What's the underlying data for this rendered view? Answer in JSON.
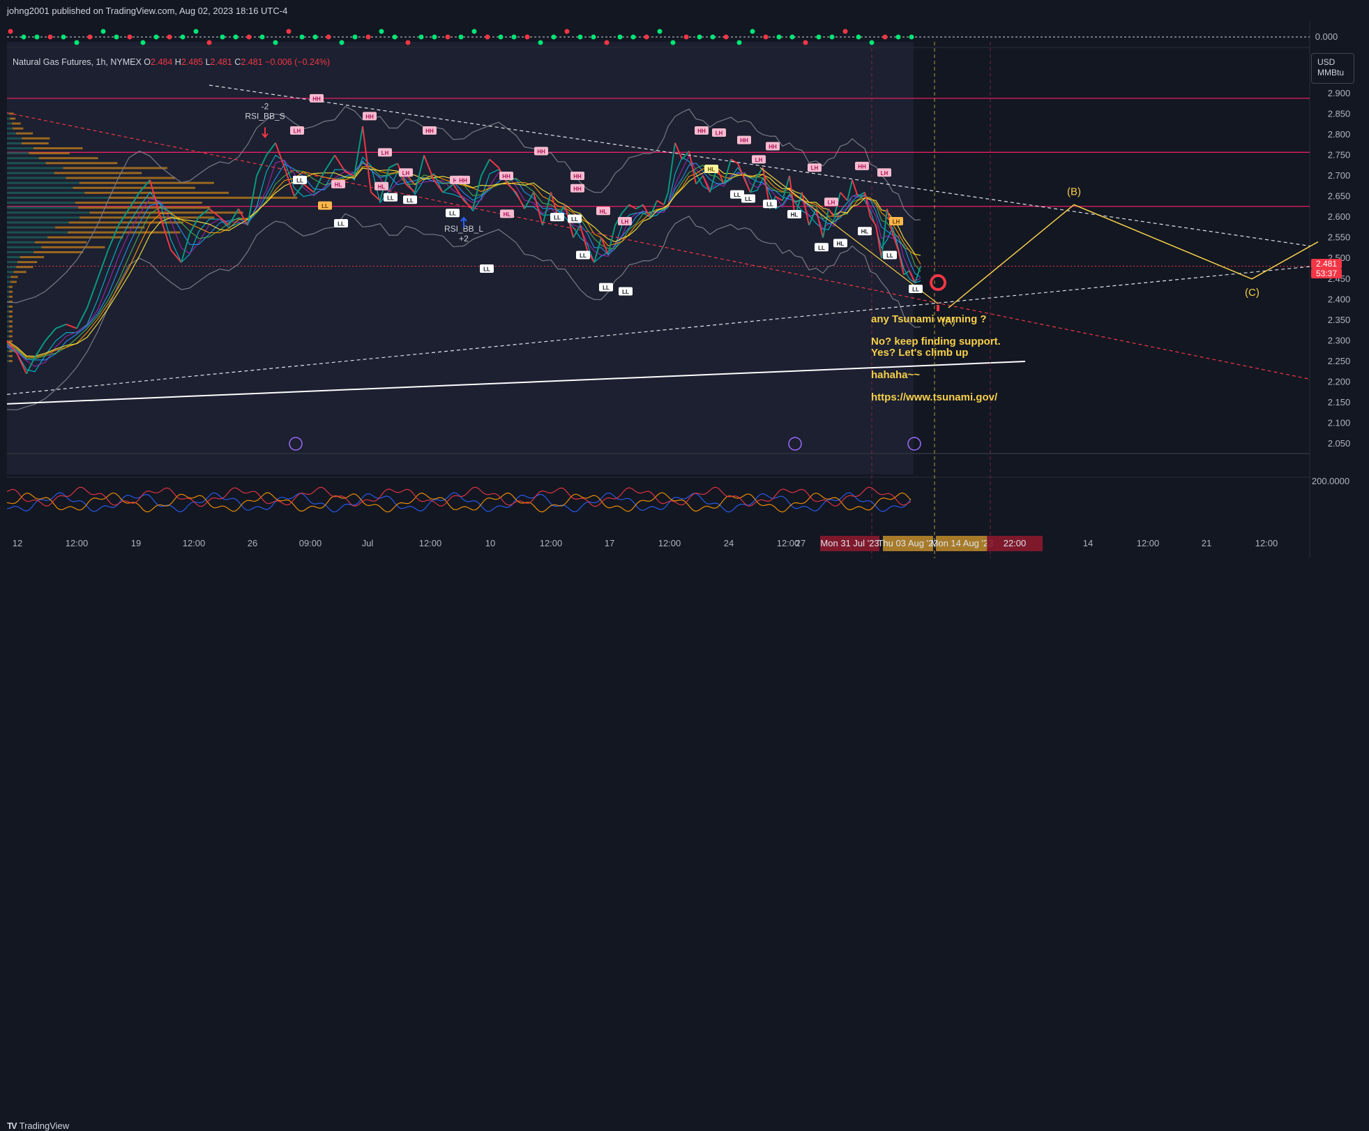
{
  "header": {
    "publish_line": "johng2001 published on TradingView.com, Aug 02, 2023 18:16 UTC-4"
  },
  "legend": {
    "symbol": "Natural Gas Futures, 1h, NYMEX",
    "o_label": "O",
    "o": "2.484",
    "h_label": "H",
    "h": "2.485",
    "l_label": "L",
    "l": "2.481",
    "c_label": "C",
    "c": "2.481",
    "change": "−0.006 (−0.24%)"
  },
  "currency": {
    "line1": "USD",
    "line2": "MMBtu"
  },
  "price_tag": {
    "price": "2.481",
    "countdown": "53:37"
  },
  "footer": {
    "brand": "TradingView"
  },
  "colors": {
    "background": "#131722",
    "up": "#089981",
    "down": "#f23645",
    "annotation": "#f7d04b",
    "resistance": "#e91e63",
    "support": "#ffffff",
    "bollinger": "#787b86"
  },
  "chart_data": {
    "type": "line",
    "symbol": "Natural Gas Futures",
    "interval": "1h",
    "y_axis_ticks": [
      "2.900",
      "2.850",
      "2.800",
      "2.750",
      "2.700",
      "2.650",
      "2.600",
      "2.550",
      "2.500",
      "2.450",
      "2.400",
      "2.350",
      "2.300",
      "2.250",
      "2.200",
      "2.150",
      "2.100",
      "2.050"
    ],
    "ylim": [
      2.03,
      2.92
    ],
    "x_axis_ticks": [
      "12",
      "12:00",
      "19",
      "12:00",
      "26",
      "09:00",
      "Jul",
      "12:00",
      "10",
      "12:00",
      "17",
      "12:00",
      "24",
      "12:00",
      "27",
      "14",
      "12:00",
      "21",
      "12:00"
    ],
    "x_highlight_labels": [
      "Mon 31 Jul '23",
      "Thu 03 Aug '23",
      "Mon 14 Aug '23",
      "22:00"
    ],
    "indicator_top_value": "0.000",
    "indicator_bottom_value": "200.0000",
    "horizontal_levels": [
      2.888,
      2.757,
      2.626,
      2.481
    ],
    "price_series": {
      "name": "",
      "x": [
        0,
        14,
        28,
        40,
        55,
        70,
        85,
        100,
        115,
        130,
        145,
        160,
        175,
        190,
        205,
        220,
        235,
        250,
        262,
        275,
        290,
        305,
        318,
        332,
        345,
        358,
        372,
        385,
        398,
        412,
        425,
        440,
        455,
        470,
        485,
        498,
        510,
        522,
        535,
        548,
        560,
        572,
        585,
        598,
        612,
        625,
        640,
        655,
        668,
        680,
        692,
        705,
        718,
        730,
        742,
        755,
        768,
        780,
        790,
        800,
        812,
        822,
        832,
        842,
        852,
        862,
        872,
        882,
        892,
        902,
        912,
        922,
        932,
        942,
        948,
        958,
        968,
        978,
        988,
        998,
        1008,
        1018,
        1028,
        1038,
        1048,
        1058,
        1066,
        1076,
        1084,
        1094,
        1102,
        1112,
        1122,
        1130,
        1140,
        1150,
        1160,
        1170,
        1178,
        1186,
        1195,
        1205,
        1212,
        1220,
        1230,
        1238,
        1246,
        1254,
        1262,
        1270,
        1278,
        1286,
        1294,
        1302,
        1310
      ],
      "y": [
        2.3,
        2.27,
        2.22,
        2.26,
        2.3,
        2.33,
        2.34,
        2.33,
        2.38,
        2.45,
        2.52,
        2.58,
        2.62,
        2.66,
        2.69,
        2.6,
        2.52,
        2.49,
        2.56,
        2.6,
        2.62,
        2.6,
        2.58,
        2.62,
        2.58,
        2.7,
        2.75,
        2.78,
        2.72,
        2.65,
        2.68,
        2.66,
        2.71,
        2.75,
        2.71,
        2.7,
        2.82,
        2.66,
        2.64,
        2.72,
        2.73,
        2.68,
        2.66,
        2.75,
        2.69,
        2.66,
        2.68,
        2.64,
        2.62,
        2.7,
        2.74,
        2.72,
        2.68,
        2.66,
        2.62,
        2.66,
        2.58,
        2.66,
        2.6,
        2.63,
        2.55,
        2.58,
        2.52,
        2.49,
        2.55,
        2.51,
        2.58,
        2.61,
        2.63,
        2.62,
        2.63,
        2.6,
        2.64,
        2.63,
        2.66,
        2.78,
        2.74,
        2.76,
        2.68,
        2.7,
        2.66,
        2.72,
        2.68,
        2.74,
        2.73,
        2.69,
        2.66,
        2.7,
        2.72,
        2.62,
        2.65,
        2.64,
        2.7,
        2.6,
        2.66,
        2.58,
        2.62,
        2.55,
        2.62,
        2.6,
        2.66,
        2.64,
        2.69,
        2.65,
        2.66,
        2.6,
        2.58,
        2.5,
        2.62,
        2.56,
        2.52,
        2.46,
        2.47,
        2.44,
        2.481
      ]
    },
    "projection": {
      "name": "",
      "points": [
        {
          "label": "(A)",
          "x": 1350,
          "y": 2.38
        },
        {
          "label": "(B)",
          "x": 1530,
          "y": 2.63
        },
        {
          "label": "(C)",
          "x": 1785,
          "y": 2.45
        },
        {
          "label": "",
          "x": 1880,
          "y": 2.54
        }
      ]
    },
    "pivot_labels": [
      {
        "text": "HH",
        "x": 444,
        "y": 2.888,
        "tone": "pink"
      },
      {
        "text": "LH",
        "x": 416,
        "y": 2.81,
        "tone": "pink"
      },
      {
        "text": "LL",
        "x": 420,
        "y": 2.69,
        "tone": "white"
      },
      {
        "text": "LL",
        "x": 456,
        "y": 2.628,
        "tone": "orange"
      },
      {
        "text": "LL",
        "x": 479,
        "y": 2.585,
        "tone": "white"
      },
      {
        "text": "HH",
        "x": 520,
        "y": 2.845,
        "tone": "pink"
      },
      {
        "text": "HL",
        "x": 475,
        "y": 2.68,
        "tone": "pink"
      },
      {
        "text": "LH",
        "x": 542,
        "y": 2.757,
        "tone": "pink"
      },
      {
        "text": "HL",
        "x": 537,
        "y": 2.675,
        "tone": "pink"
      },
      {
        "text": "LL",
        "x": 550,
        "y": 2.648,
        "tone": "white"
      },
      {
        "text": "LH",
        "x": 572,
        "y": 2.708,
        "tone": "pink"
      },
      {
        "text": "LL",
        "x": 578,
        "y": 2.642,
        "tone": "white"
      },
      {
        "text": "HH",
        "x": 606,
        "y": 2.81,
        "tone": "pink"
      },
      {
        "text": "HL",
        "x": 645,
        "y": 2.69,
        "tone": "pink"
      },
      {
        "text": "LL",
        "x": 639,
        "y": 2.61,
        "tone": "white"
      },
      {
        "text": "HH",
        "x": 654,
        "y": 2.69,
        "tone": "pink"
      },
      {
        "text": "HL",
        "x": 717,
        "y": 2.608,
        "tone": "pink"
      },
      {
        "text": "LL",
        "x": 688,
        "y": 2.475,
        "tone": "white"
      },
      {
        "text": "HH",
        "x": 716,
        "y": 2.7,
        "tone": "pink"
      },
      {
        "text": "HH",
        "x": 766,
        "y": 2.76,
        "tone": "pink"
      },
      {
        "text": "HH",
        "x": 818,
        "y": 2.67,
        "tone": "pink"
      },
      {
        "text": "LL",
        "x": 789,
        "y": 2.6,
        "tone": "white"
      },
      {
        "text": "LL",
        "x": 814,
        "y": 2.596,
        "tone": "white"
      },
      {
        "text": "HH",
        "x": 818,
        "y": 2.7,
        "tone": "pink"
      },
      {
        "text": "HL",
        "x": 855,
        "y": 2.615,
        "tone": "pink"
      },
      {
        "text": "LL",
        "x": 826,
        "y": 2.508,
        "tone": "white"
      },
      {
        "text": "LH",
        "x": 886,
        "y": 2.59,
        "tone": "pink"
      },
      {
        "text": "LL",
        "x": 859,
        "y": 2.43,
        "tone": "white"
      },
      {
        "text": "LL",
        "x": 887,
        "y": 2.42,
        "tone": "white"
      },
      {
        "text": "HH",
        "x": 996,
        "y": 2.81,
        "tone": "pink"
      },
      {
        "text": "LH",
        "x": 1021,
        "y": 2.805,
        "tone": "pink"
      },
      {
        "text": "HL",
        "x": 1010,
        "y": 2.717,
        "tone": "yellow"
      },
      {
        "text": "HH",
        "x": 1057,
        "y": 2.787,
        "tone": "pink"
      },
      {
        "text": "LL",
        "x": 1047,
        "y": 2.655,
        "tone": "white"
      },
      {
        "text": "LL",
        "x": 1063,
        "y": 2.645,
        "tone": "white"
      },
      {
        "text": "HH",
        "x": 1098,
        "y": 2.772,
        "tone": "pink"
      },
      {
        "text": "LH",
        "x": 1078,
        "y": 2.74,
        "tone": "pink"
      },
      {
        "text": "LL",
        "x": 1094,
        "y": 2.632,
        "tone": "white"
      },
      {
        "text": "HL",
        "x": 1129,
        "y": 2.607,
        "tone": "white"
      },
      {
        "text": "LH",
        "x": 1158,
        "y": 2.72,
        "tone": "pink"
      },
      {
        "text": "LH",
        "x": 1182,
        "y": 2.637,
        "tone": "pink"
      },
      {
        "text": "LL",
        "x": 1168,
        "y": 2.527,
        "tone": "white"
      },
      {
        "text": "HL",
        "x": 1195,
        "y": 2.537,
        "tone": "white"
      },
      {
        "text": "HH",
        "x": 1226,
        "y": 2.724,
        "tone": "pink"
      },
      {
        "text": "HL",
        "x": 1230,
        "y": 2.566,
        "tone": "white"
      },
      {
        "text": "LH",
        "x": 1258,
        "y": 2.708,
        "tone": "pink"
      },
      {
        "text": "LH",
        "x": 1275,
        "y": 2.59,
        "tone": "orange"
      },
      {
        "text": "LL",
        "x": 1266,
        "y": 2.508,
        "tone": "white"
      },
      {
        "text": "LL",
        "x": 1303,
        "y": 2.426,
        "tone": "white"
      }
    ],
    "signal_labels": [
      {
        "line1": "-2",
        "line2": "RSI_BB_S",
        "x": 370,
        "y": 2.838,
        "direction": "down"
      },
      {
        "line1": "RSI_BB_L",
        "line2": "+2",
        "x": 655,
        "y": 2.541,
        "direction": "up"
      }
    ],
    "wave_labels": [
      "(A)",
      "(B)",
      "(C)"
    ],
    "annotations": [
      "any Tsunami warning ?",
      "No? keep finding support.",
      "Yes? Let's climb up",
      "hahaha~~",
      "https://www.tsunami.gov/"
    ]
  }
}
